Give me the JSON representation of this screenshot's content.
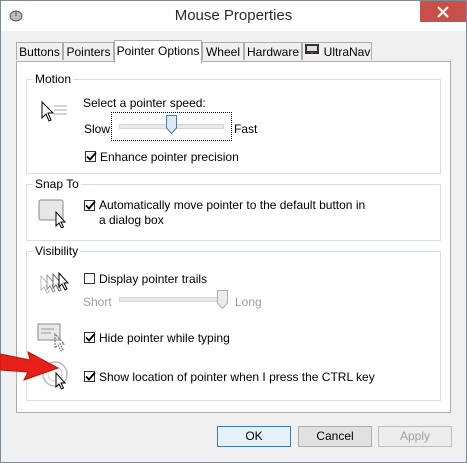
{
  "window": {
    "title": "Mouse Properties"
  },
  "tabs": [
    {
      "label": "Buttons"
    },
    {
      "label": "Pointers"
    },
    {
      "label": "Pointer Options",
      "active": true
    },
    {
      "label": "Wheel"
    },
    {
      "label": "Hardware"
    },
    {
      "label": "UltraNav"
    }
  ],
  "motion": {
    "label": "Motion",
    "speed_label": "Select a pointer speed:",
    "slow": "Slow",
    "fast": "Fast",
    "speed_level": 0.5,
    "enhance_label": "Enhance pointer precision",
    "enhance_checked": true
  },
  "snap_to": {
    "label": "Snap To",
    "auto_label": "Automatically move pointer to the default button in a dialog box",
    "auto_checked": true
  },
  "visibility": {
    "label": "Visibility",
    "trails_label": "Display pointer trails",
    "trails_checked": false,
    "short": "Short",
    "long": "Long",
    "trails_level": 1.0,
    "hide_label": "Hide pointer while typing",
    "hide_checked": true,
    "show_ctrl_label": "Show location of pointer when I press the CTRL key",
    "show_ctrl_checked": true
  },
  "buttons": {
    "ok": "OK",
    "cancel": "Cancel",
    "apply": "Apply"
  },
  "colors": {
    "annotation_arrow": "#e8201a",
    "close_button": "#c7504a"
  }
}
